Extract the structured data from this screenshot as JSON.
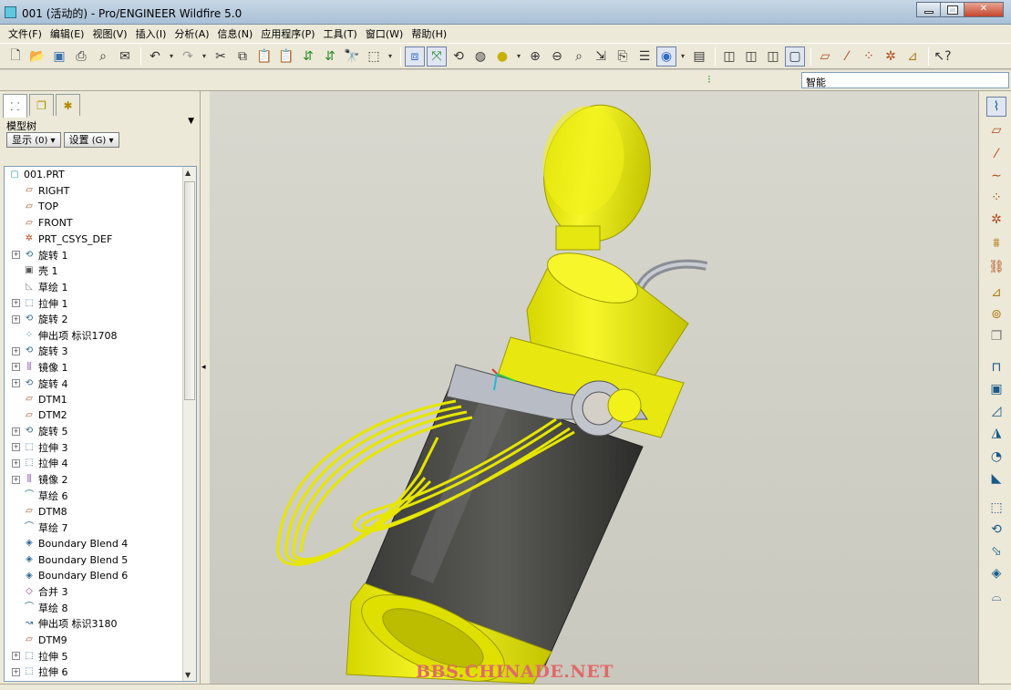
{
  "window": {
    "title": "001 (活动的) - Pro/ENGINEER Wildfire 5.0"
  },
  "menu": [
    "文件(F)",
    "编辑(E)",
    "视图(V)",
    "插入(I)",
    "分析(A)",
    "信息(N)",
    "应用程序(P)",
    "工具(T)",
    "窗口(W)",
    "帮助(H)"
  ],
  "filter": {
    "value": "智能"
  },
  "model_tree": {
    "label": "模型树",
    "show_button": "显示",
    "show_shortcut": "(0)",
    "settings_button": "设置",
    "settings_shortcut": "(G)",
    "items": [
      {
        "label": "001.PRT",
        "icon": "part-icon",
        "expand": false,
        "level": 0
      },
      {
        "label": "RIGHT",
        "icon": "datum-plane-icon",
        "expand": false,
        "level": 1
      },
      {
        "label": "TOP",
        "icon": "datum-plane-icon",
        "expand": false,
        "level": 1
      },
      {
        "label": "FRONT",
        "icon": "datum-plane-icon",
        "expand": false,
        "level": 1
      },
      {
        "label": "PRT_CSYS_DEF",
        "icon": "csys-icon",
        "expand": false,
        "level": 1
      },
      {
        "label": "旋转 1",
        "icon": "revolve-icon",
        "expand": true,
        "level": 1
      },
      {
        "label": "壳 1",
        "icon": "shell-icon",
        "expand": false,
        "level": 1
      },
      {
        "label": "草绘 1",
        "icon": "sketch-icon",
        "expand": false,
        "level": 1
      },
      {
        "label": "拉伸 1",
        "icon": "extrude-icon",
        "expand": true,
        "level": 1
      },
      {
        "label": "旋转 2",
        "icon": "revolve-icon",
        "expand": true,
        "level": 1
      },
      {
        "label": "伸出项 标识1708",
        "icon": "protrusion-icon",
        "expand": false,
        "level": 1
      },
      {
        "label": "旋转 3",
        "icon": "revolve-icon",
        "expand": true,
        "level": 1
      },
      {
        "label": "镜像 1",
        "icon": "mirror-icon",
        "expand": true,
        "level": 1
      },
      {
        "label": "旋转 4",
        "icon": "revolve-icon",
        "expand": true,
        "level": 1
      },
      {
        "label": "DTM1",
        "icon": "datum-plane-icon",
        "expand": false,
        "level": 1
      },
      {
        "label": "DTM2",
        "icon": "datum-plane-icon",
        "expand": false,
        "level": 1
      },
      {
        "label": "旋转 5",
        "icon": "revolve-icon",
        "expand": true,
        "level": 1
      },
      {
        "label": "拉伸 3",
        "icon": "extrude-icon",
        "expand": true,
        "level": 1
      },
      {
        "label": "拉伸 4",
        "icon": "extrude-icon",
        "expand": true,
        "level": 1
      },
      {
        "label": "镜像 2",
        "icon": "mirror-icon",
        "expand": true,
        "level": 1
      },
      {
        "label": "草绘 6",
        "icon": "sketch-curve-icon",
        "expand": false,
        "level": 1
      },
      {
        "label": "DTM8",
        "icon": "datum-plane-icon",
        "expand": false,
        "level": 1
      },
      {
        "label": "草绘 7",
        "icon": "sketch-curve-icon",
        "expand": false,
        "level": 1
      },
      {
        "label": "Boundary Blend 4",
        "icon": "boundary-blend-icon",
        "expand": false,
        "level": 1
      },
      {
        "label": "Boundary Blend 5",
        "icon": "boundary-blend-icon",
        "expand": false,
        "level": 1
      },
      {
        "label": "Boundary Blend 6",
        "icon": "boundary-blend-icon",
        "expand": false,
        "level": 1
      },
      {
        "label": "合并 3",
        "icon": "merge-icon",
        "expand": false,
        "level": 1
      },
      {
        "label": "草绘 8",
        "icon": "sketch-curve-icon",
        "expand": false,
        "level": 1
      },
      {
        "label": "伸出项 标识3180",
        "icon": "sweep-icon",
        "expand": false,
        "level": 1
      },
      {
        "label": "DTM9",
        "icon": "datum-plane-icon",
        "expand": false,
        "level": 1
      },
      {
        "label": "拉伸 5",
        "icon": "extrude-icon",
        "expand": true,
        "level": 1
      },
      {
        "label": "拉伸 6",
        "icon": "extrude-icon",
        "expand": true,
        "level": 1
      }
    ]
  },
  "viewport": {
    "watermark": "BBS.CHINADE.NET",
    "model_colors": {
      "body": "#f2f21a",
      "body_dark": "#c8c800",
      "sleeve": "#4a4a48",
      "clip": "#b8bcc4"
    }
  },
  "colors": {
    "accent": "#316ac5",
    "menubar": "#ece9d8"
  }
}
